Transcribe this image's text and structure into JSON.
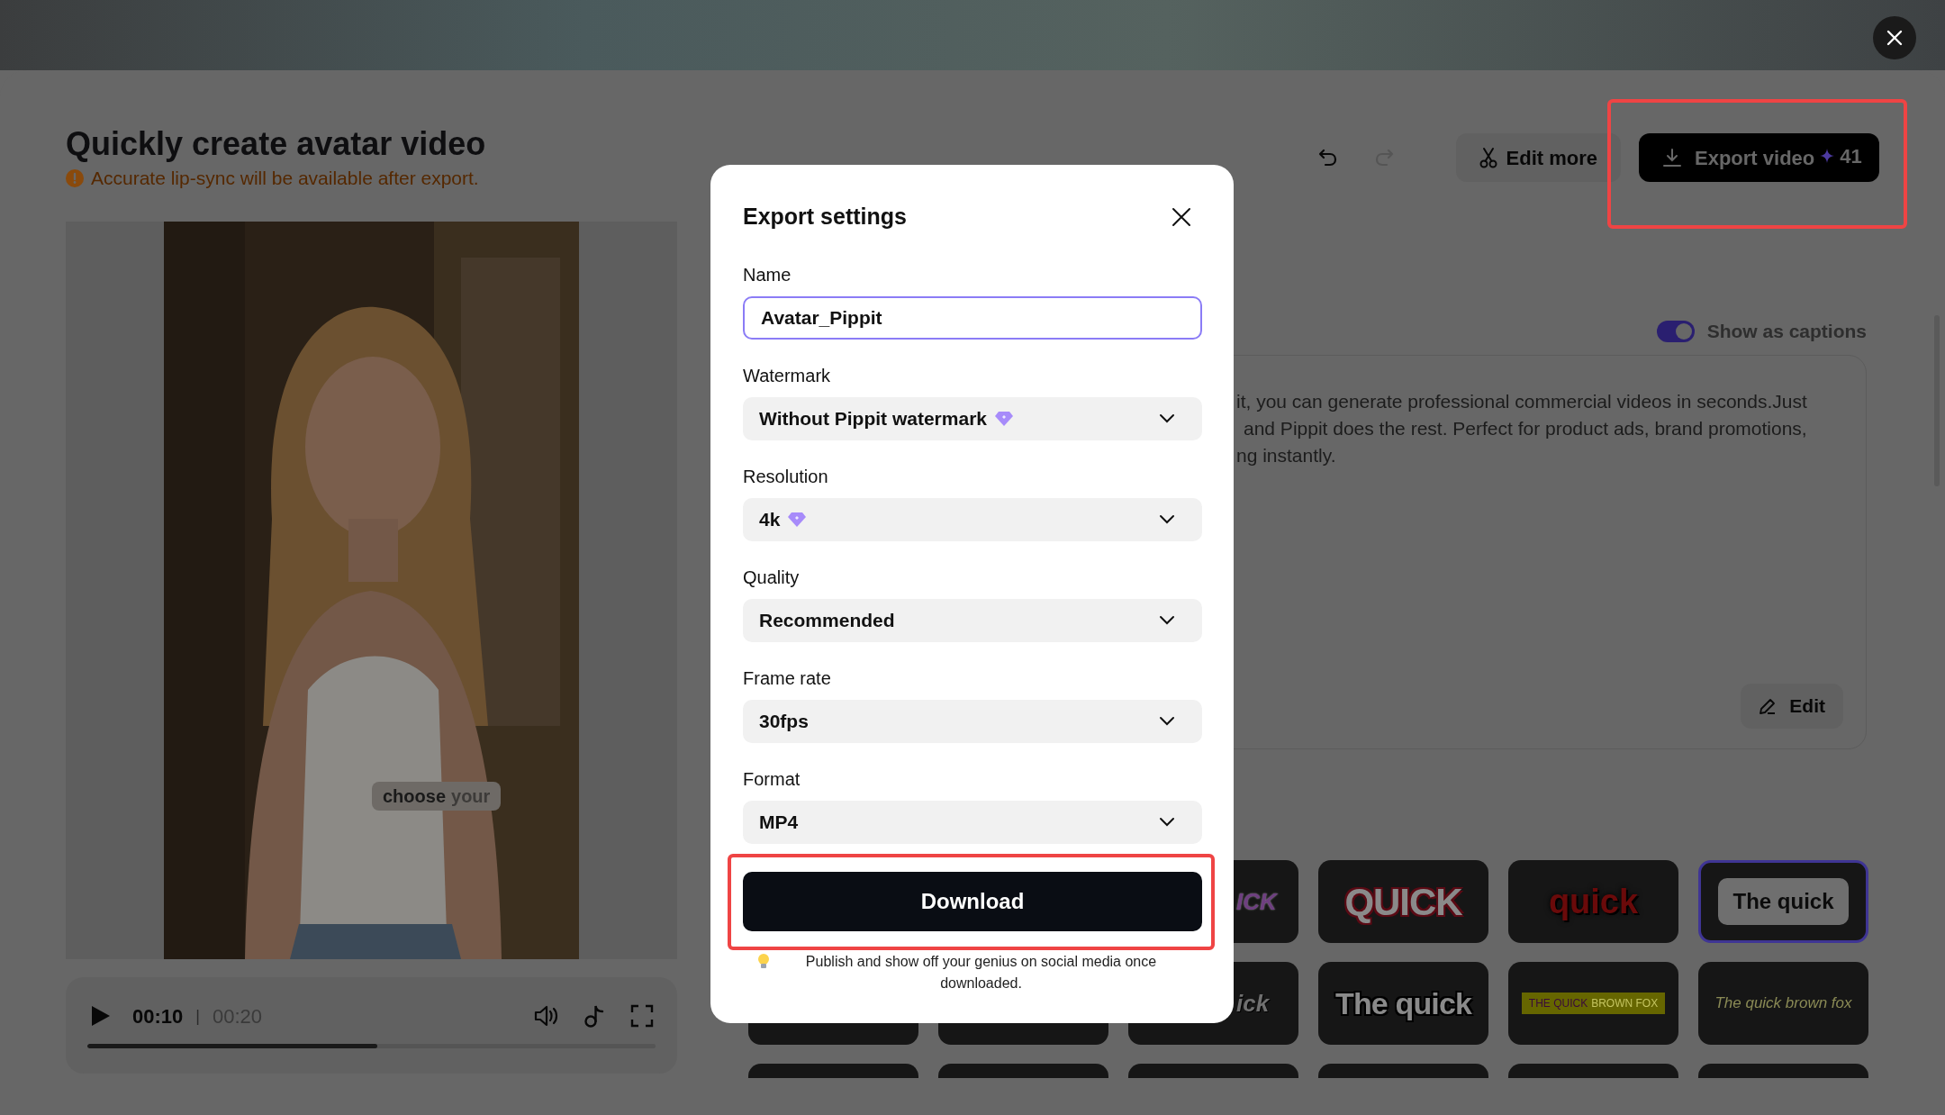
{
  "page": {
    "title": "Quickly create avatar video",
    "warning": "Accurate lip-sync will be available after export."
  },
  "video": {
    "caption_words": [
      {
        "text": "choose",
        "highlighted": true
      },
      {
        "text": "your",
        "highlighted": false
      }
    ],
    "current_time": "00:10",
    "separator": "|",
    "total_time": "00:20",
    "progress": {
      "level": 0.51
    }
  },
  "toolbar": {
    "undo": {
      "disabled": false
    },
    "redo": {
      "disabled": true
    },
    "edit_more": "Edit more",
    "export": {
      "label": "Export video",
      "credits": "41",
      "highlighted": true
    }
  },
  "captions_toggle": {
    "label": "Show as captions",
    "on": true
  },
  "script_card": {
    "lines": [
      "it, you can generate professional commercial videos in seconds.Just",
      "and Pippit does the rest. Perfect for product ads, brand promotions,",
      "ng instantly."
    ],
    "edit_label": "Edit"
  },
  "caption_styles": [
    [
      {
        "kind": "italic-purple",
        "text": "ICK",
        "selected": false
      },
      {
        "kind": "outlined-caps",
        "text": "QUICK",
        "selected": false
      },
      {
        "kind": "red-glow",
        "text": "quick",
        "selected": false
      },
      {
        "kind": "pill",
        "text": "The quick",
        "selected": true
      }
    ],
    [
      {
        "kind": "blank",
        "selected": false
      },
      {
        "kind": "blank",
        "selected": false
      },
      {
        "kind": "italic-outline",
        "text": "ick",
        "selected": false
      },
      {
        "kind": "condensed",
        "text": "The quick",
        "selected": false
      },
      {
        "kind": "yellow-bar",
        "text": "THE QUICK",
        "text_2": "BROWN FOX",
        "selected": false
      },
      {
        "kind": "italic-olive",
        "text": "The quick brown fox",
        "selected": false
      }
    ],
    [
      {
        "kind": "blank",
        "selected": false
      },
      {
        "kind": "blank",
        "selected": false
      },
      {
        "kind": "blank",
        "selected": false
      },
      {
        "kind": "blank",
        "selected": false
      },
      {
        "kind": "blank",
        "selected": false
      },
      {
        "kind": "blank",
        "selected": false
      }
    ]
  ],
  "export_dialog": {
    "title": "Export settings",
    "fields": [
      {
        "label": "Name",
        "kind": "input",
        "value": "Avatar_Pippit",
        "premium": false
      },
      {
        "label": "Watermark",
        "kind": "select",
        "value": "Without Pippit watermark",
        "premium": true
      },
      {
        "label": "Resolution",
        "kind": "select",
        "value": "4k",
        "premium": true
      },
      {
        "label": "Quality",
        "kind": "select",
        "value": "Recommended",
        "premium": false
      },
      {
        "label": "Frame rate",
        "kind": "select",
        "value": "30fps",
        "premium": false
      },
      {
        "label": "Format",
        "kind": "select",
        "value": "MP4",
        "premium": false
      }
    ],
    "download": {
      "label": "Download",
      "highlighted": true
    },
    "tip": "Publish and show off your genius on social media once downloaded."
  }
}
